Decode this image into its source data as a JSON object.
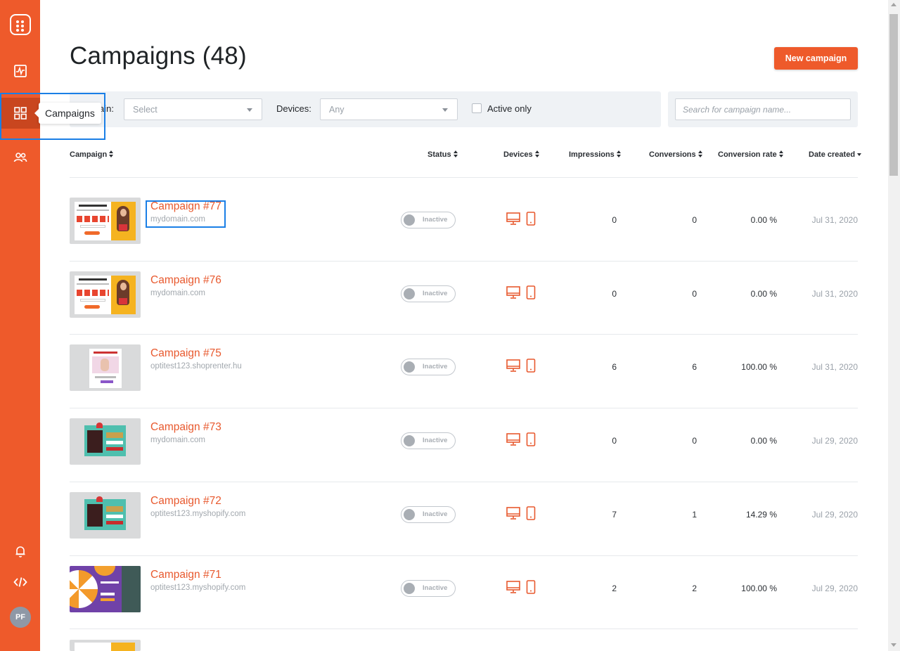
{
  "sidebar": {
    "items": [
      {
        "name": "dashboard",
        "icon": "activity-chart-icon"
      },
      {
        "name": "campaigns",
        "icon": "grid-icon",
        "active": true
      },
      {
        "name": "subscribers",
        "icon": "users-icon"
      },
      {
        "name": "notifications",
        "icon": "bell-icon"
      },
      {
        "name": "code",
        "icon": "code-icon"
      }
    ],
    "avatar_initials": "PF",
    "tooltip": "Campaigns"
  },
  "header": {
    "title": "Campaigns (48)",
    "new_button": "New campaign"
  },
  "filters": {
    "domain_label": "Domain:",
    "domain_visible_label": "ain:",
    "domain_value": "Select",
    "devices_label": "Devices:",
    "devices_value": "Any",
    "active_only_label": "Active only",
    "active_only_checked": false,
    "search_placeholder": "Search for campaign name..."
  },
  "table": {
    "columns": {
      "campaign": "Campaign",
      "status": "Status",
      "devices": "Devices",
      "impressions": "Impressions",
      "conversions": "Conversions",
      "conversion_rate": "Conversion rate",
      "date_created": "Date created"
    },
    "rows": [
      {
        "name": "Campaign #77",
        "domain": "mydomain.com",
        "status": "Inactive",
        "impressions": "0",
        "conversions": "0",
        "rate": "0.00 %",
        "date": "Jul 31, 2020",
        "thumb": "gift"
      },
      {
        "name": "Campaign #76",
        "domain": "mydomain.com",
        "status": "Inactive",
        "impressions": "0",
        "conversions": "0",
        "rate": "0.00 %",
        "date": "Jul 31, 2020",
        "thumb": "gift"
      },
      {
        "name": "Campaign #75",
        "domain": "optitest123.shoprenter.hu",
        "status": "Inactive",
        "impressions": "6",
        "conversions": "6",
        "rate": "100.00 %",
        "date": "Jul 31, 2020",
        "thumb": "newsletter"
      },
      {
        "name": "Campaign #73",
        "domain": "mydomain.com",
        "status": "Inactive",
        "impressions": "0",
        "conversions": "0",
        "rate": "0.00 %",
        "date": "Jul 29, 2020",
        "thumb": "christmas"
      },
      {
        "name": "Campaign #72",
        "domain": "optitest123.myshopify.com",
        "status": "Inactive",
        "impressions": "7",
        "conversions": "1",
        "rate": "14.29 %",
        "date": "Jul 29, 2020",
        "thumb": "christmas"
      },
      {
        "name": "Campaign #71",
        "domain": "optitest123.myshopify.com",
        "status": "Inactive",
        "impressions": "2",
        "conversions": "2",
        "rate": "100.00 %",
        "date": "Jul 29, 2020",
        "thumb": "wheel"
      }
    ]
  },
  "colors": {
    "brand": "#ee5a2b",
    "sidebar_active": "#c9461f",
    "highlight": "#1a7fe6"
  }
}
